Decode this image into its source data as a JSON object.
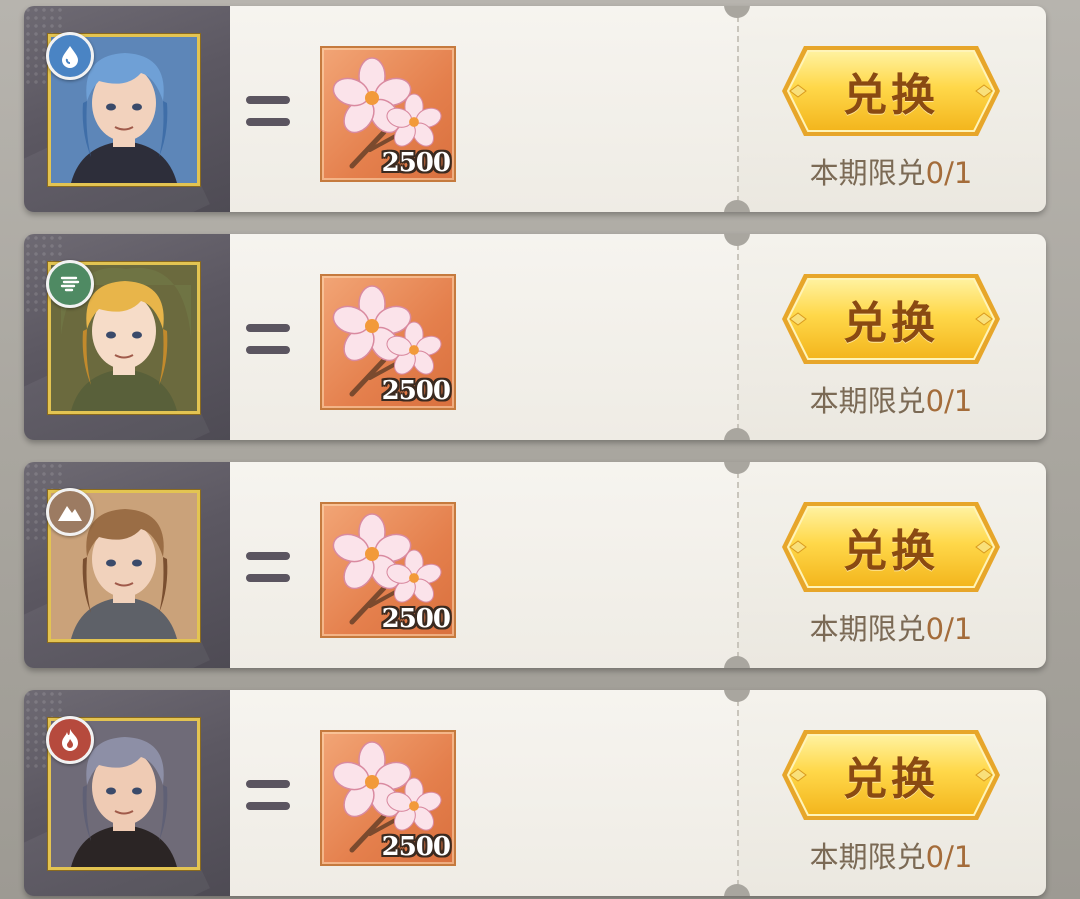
{
  "rows": [
    {
      "element": "water",
      "element_icon": "water-drop-icon",
      "element_color": "#4a84c4",
      "hero": "blue-haired-hero",
      "equals": "=",
      "item": "cherry-blossom-icon",
      "item_count": "2500",
      "button_label": "兑换",
      "limit_label": "本期限兑",
      "limit_count": "0/1"
    },
    {
      "element": "wind",
      "element_icon": "wind-swirl-icon",
      "element_color": "#4f8a63",
      "hero": "blonde-hooded-hero",
      "equals": "=",
      "item": "cherry-blossom-icon",
      "item_count": "2500",
      "button_label": "兑换",
      "limit_label": "本期限兑",
      "limit_count": "0/1"
    },
    {
      "element": "earth",
      "element_icon": "mountain-icon",
      "element_color": "#9c7b62",
      "hero": "brown-haired-knight",
      "equals": "=",
      "item": "cherry-blossom-icon",
      "item_count": "2500",
      "button_label": "兑换",
      "limit_label": "本期限兑",
      "limit_count": "0/1"
    },
    {
      "element": "fire",
      "element_icon": "flame-icon",
      "element_color": "#b64a3d",
      "hero": "silver-haired-hero",
      "equals": "=",
      "item": "cherry-blossom-icon",
      "item_count": "2500",
      "button_label": "兑换",
      "limit_label": "本期限兑",
      "limit_count": "0/1"
    }
  ]
}
